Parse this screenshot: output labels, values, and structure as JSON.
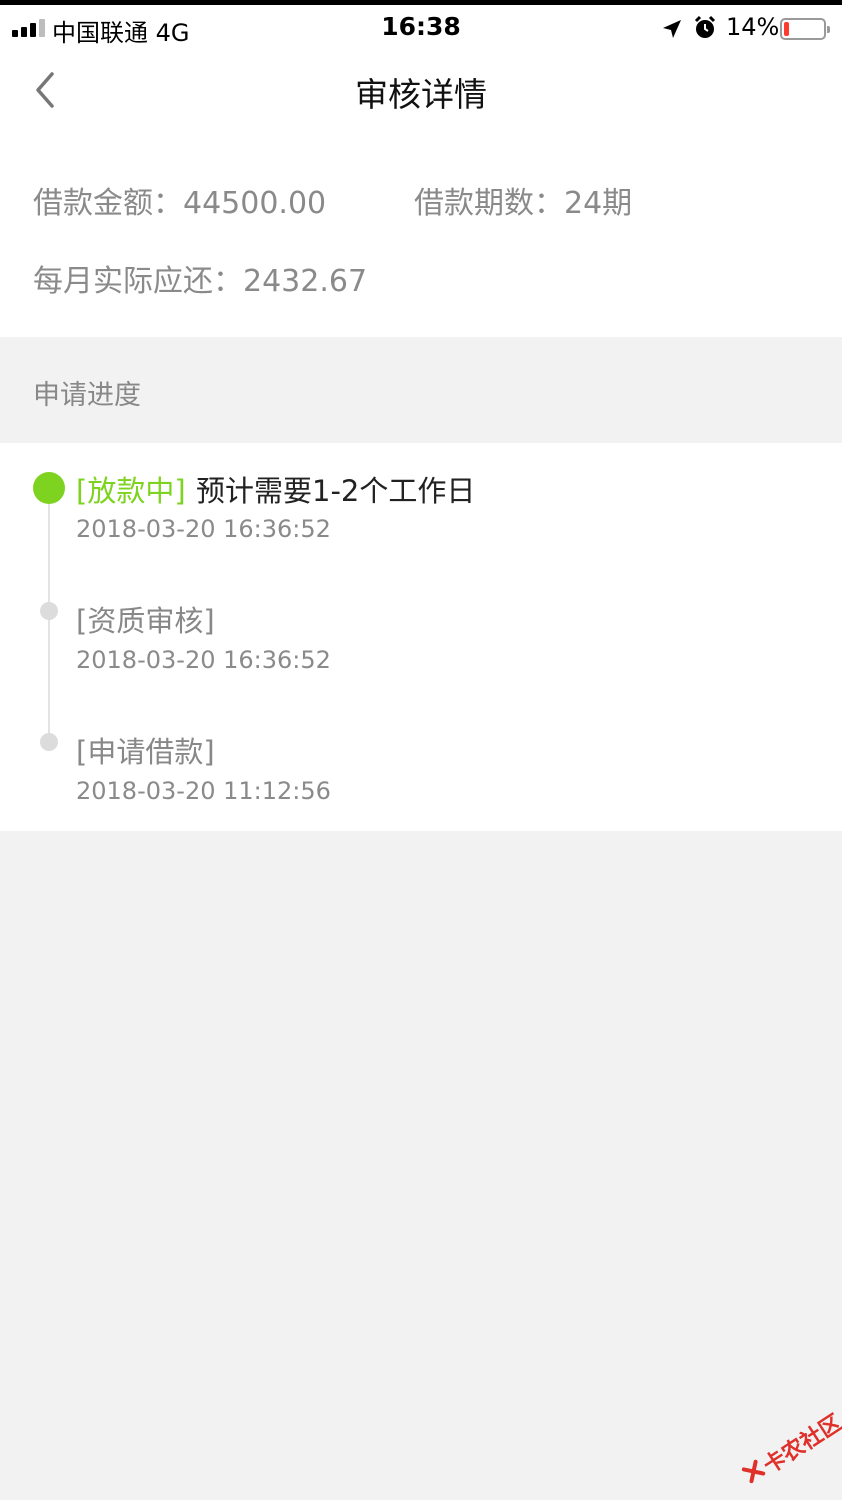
{
  "status_bar": {
    "carrier": "中国联通   4G",
    "time": "16:38",
    "battery": "14%",
    "battery_level": 0.14,
    "signal_bars_filled": 3,
    "signal_bars_total": 4
  },
  "nav": {
    "title": "审核详情",
    "back_icon": "chevron-left-icon"
  },
  "summary": {
    "loan_amount": "借款金额：44500.00",
    "loan_periods": "借款期数：24期",
    "monthly_repayment": "每月实际应还：2432.67"
  },
  "progress": {
    "section_title": "申请进度",
    "steps": [
      {
        "status": "[放款中]",
        "note": "预计需要1-2个工作日",
        "time": "2018-03-20 16:36:52",
        "active": true
      },
      {
        "status": "[资质审核]",
        "time": "2018-03-20 16:36:52",
        "active": false
      },
      {
        "status": "[申请借款]",
        "time": "2018-03-20 11:12:56",
        "active": false
      }
    ]
  },
  "watermark": {
    "text": "卡农社区"
  },
  "colors": {
    "accent_green": "#7ed321",
    "muted_text": "#8a8a8a",
    "background": "#f2f2f2",
    "battery_low": "#ff3b30",
    "watermark_red": "#e0302a"
  }
}
